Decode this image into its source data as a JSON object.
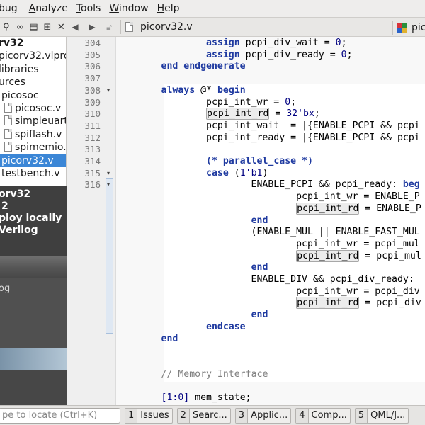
{
  "menu": [
    {
      "label": "bug",
      "underline": ""
    },
    {
      "label": "Analyze",
      "underline": "A"
    },
    {
      "label": "Tools",
      "underline": "T"
    },
    {
      "label": "Window",
      "underline": "W"
    },
    {
      "label": "Help",
      "underline": "H"
    }
  ],
  "left_toolbar_icons": [
    "filter-icon",
    "link-icon",
    "split-icon",
    "add-split-icon",
    "close-icon"
  ],
  "tree": [
    {
      "label": "rv32",
      "bold": true,
      "icon": false,
      "selected": false
    },
    {
      "label": "picorv32.vlpro",
      "bold": false,
      "icon": false,
      "selected": false
    },
    {
      "label": "libraries",
      "bold": false,
      "icon": false,
      "selected": false
    },
    {
      "label": "urces",
      "bold": false,
      "icon": false,
      "selected": false
    },
    {
      "label": "picosoc",
      "bold": false,
      "icon": false,
      "selected": false
    },
    {
      "label": "picosoc.v",
      "bold": false,
      "icon": true,
      "selected": false
    },
    {
      "label": "simpleuart",
      "bold": false,
      "icon": true,
      "selected": false
    },
    {
      "label": "spiflash.v",
      "bold": false,
      "icon": true,
      "selected": false
    },
    {
      "label": "spimemio.",
      "bold": false,
      "icon": true,
      "selected": false
    },
    {
      "label": "picorv32.v",
      "bold": false,
      "icon": false,
      "selected": true
    },
    {
      "label": "testbench.v",
      "bold": false,
      "icon": false,
      "selected": false
    }
  ],
  "popup": {
    "head_lines": [
      "orv32",
      "2",
      "ploy locally",
      "Verilog"
    ],
    "mid_line": "og"
  },
  "editor_toolbar": {
    "file_title": "picorv32.v",
    "symbol_title": "picorv32"
  },
  "gutter": [
    {
      "n": "304",
      "fold": ""
    },
    {
      "n": "305",
      "fold": ""
    },
    {
      "n": "306",
      "fold": ""
    },
    {
      "n": "307",
      "fold": ""
    },
    {
      "n": "308",
      "fold": "▾"
    },
    {
      "n": "309",
      "fold": ""
    },
    {
      "n": "310",
      "fold": ""
    },
    {
      "n": "311",
      "fold": ""
    },
    {
      "n": "312",
      "fold": ""
    },
    {
      "n": "313",
      "fold": ""
    },
    {
      "n": "314",
      "fold": ""
    },
    {
      "n": "315",
      "fold": "▾"
    },
    {
      "n": "316",
      "fold": "▾"
    }
  ],
  "code_lines": [
    [
      {
        "t": "                "
      },
      {
        "t": "assign",
        "c": "kw"
      },
      {
        "t": " pcpi_div_wait = "
      },
      {
        "t": "0",
        "c": "num"
      },
      {
        "t": ";"
      }
    ],
    [
      {
        "t": "                "
      },
      {
        "t": "assign",
        "c": "kw"
      },
      {
        "t": " pcpi_div_ready = "
      },
      {
        "t": "0",
        "c": "num"
      },
      {
        "t": ";"
      }
    ],
    [
      {
        "t": "        "
      },
      {
        "t": "end endgenerate",
        "c": "kw"
      }
    ],
    [
      {
        "t": ""
      }
    ],
    [
      {
        "t": "        "
      },
      {
        "t": "always",
        "c": "kw"
      },
      {
        "t": " @* "
      },
      {
        "t": "begin",
        "c": "kw"
      }
    ],
    [
      {
        "t": "                pcpi_int_wr = "
      },
      {
        "t": "0",
        "c": "num"
      },
      {
        "t": ";"
      }
    ],
    [
      {
        "t": "                "
      },
      {
        "t": "pcpi_int_rd",
        "c": "box"
      },
      {
        "t": " = "
      },
      {
        "t": "32'bx",
        "c": "num"
      },
      {
        "t": ";"
      }
    ],
    [
      {
        "t": "                pcpi_int_wait  = |{ENABLE_PCPI && pcpi"
      }
    ],
    [
      {
        "t": "                pcpi_int_ready = |{ENABLE_PCPI && pcpi"
      }
    ],
    [
      {
        "t": ""
      }
    ],
    [
      {
        "t": "                "
      },
      {
        "t": "(* parallel_case *)",
        "c": "kw"
      }
    ],
    [
      {
        "t": "                "
      },
      {
        "t": "case",
        "c": "kw"
      },
      {
        "t": " ("
      },
      {
        "t": "1'b1",
        "c": "num"
      },
      {
        "t": ")"
      }
    ],
    [
      {
        "t": "                        ENABLE_PCPI && pcpi_ready: "
      },
      {
        "t": "beg",
        "c": "kw"
      }
    ],
    [
      {
        "t": "                                pcpi_int_wr = ENABLE_P"
      }
    ],
    [
      {
        "t": "                                "
      },
      {
        "t": "pcpi_int_rd",
        "c": "box"
      },
      {
        "t": " = ENABLE_P"
      }
    ],
    [
      {
        "t": "                        "
      },
      {
        "t": "end",
        "c": "kw"
      }
    ],
    [
      {
        "t": "                        (ENABLE_MUL || ENABLE_FAST_MUL"
      }
    ],
    [
      {
        "t": "                                pcpi_int_wr = pcpi_mul"
      }
    ],
    [
      {
        "t": "                                "
      },
      {
        "t": "pcpi_int_rd",
        "c": "box"
      },
      {
        "t": " = pcpi_mul"
      }
    ],
    [
      {
        "t": "                        "
      },
      {
        "t": "end",
        "c": "kw"
      }
    ],
    [
      {
        "t": "                        ENABLE_DIV && pcpi_div_ready: "
      }
    ],
    [
      {
        "t": "                                pcpi_int_wr = pcpi_div"
      }
    ],
    [
      {
        "t": "                                "
      },
      {
        "t": "pcpi_int_rd",
        "c": "box"
      },
      {
        "t": " = pcpi_div"
      }
    ],
    [
      {
        "t": "                        "
      },
      {
        "t": "end",
        "c": "kw"
      }
    ],
    [
      {
        "t": "                "
      },
      {
        "t": "endcase",
        "c": "kw"
      }
    ],
    [
      {
        "t": "        "
      },
      {
        "t": "end",
        "c": "kw"
      }
    ],
    [
      {
        "t": ""
      }
    ],
    [
      {
        "t": ""
      }
    ],
    [
      {
        "t": "        "
      },
      {
        "t": "// Memory Interface",
        "c": "cm"
      }
    ],
    [
      {
        "t": ""
      }
    ],
    [
      {
        "t": "        "
      },
      {
        "t": "[1:0]",
        "c": "num"
      },
      {
        "t": " mem_state;"
      }
    ]
  ],
  "locate_placeholder": "pe to locate (Ctrl+K)",
  "bottom_tabs": [
    {
      "n": "1",
      "label": "Issues"
    },
    {
      "n": "2",
      "label": "Searc..."
    },
    {
      "n": "3",
      "label": "Applic..."
    },
    {
      "n": "4",
      "label": "Comp..."
    },
    {
      "n": "5",
      "label": "QML/J..."
    }
  ]
}
